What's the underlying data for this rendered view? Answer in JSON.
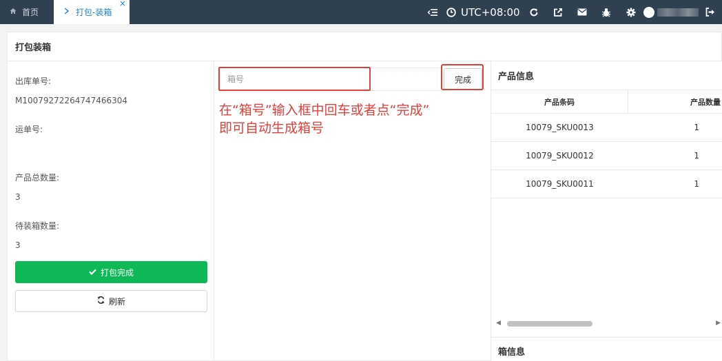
{
  "topbar": {
    "home_tab": "首页",
    "home_icon": "home-icon",
    "active_tab": "打包-装箱",
    "close_glyph": "×",
    "timezone": "UTC+08:00",
    "tools": [
      "menu-collapse-icon",
      "clock-icon",
      "refresh-icon",
      "external-link-icon",
      "mail-icon",
      "bug-icon",
      "gear-icon",
      "user-icon",
      "logout-icon"
    ]
  },
  "page": {
    "title": "打包装箱"
  },
  "left": {
    "outbound_no_label": "出库单号:",
    "outbound_no_value": "M10079272264747466304",
    "waybill_label": "运单号:",
    "waybill_value": "",
    "total_qty_label": "产品总数量:",
    "total_qty_value": "3",
    "pending_qty_label": "待装箱数量:",
    "pending_qty_value": "3",
    "done_button": "打包完成",
    "refresh_button": "刷新"
  },
  "middle": {
    "box_input_placeholder": "箱号",
    "box_input_value": "",
    "finish_button": "完成",
    "hint_line1": "在“箱号”输入框中回车或者点“完成”",
    "hint_line2": "即可自动生成箱号"
  },
  "right": {
    "product_info_title": "产品信息",
    "columns": [
      "产品条码",
      "产品数量"
    ],
    "rows": [
      {
        "barcode": "10079_SKU0013",
        "qty": "1"
      },
      {
        "barcode": "10079_SKU0012",
        "qty": "1"
      },
      {
        "barcode": "10079_SKU0011",
        "qty": "1"
      }
    ],
    "box_info_title": "箱信息"
  },
  "colors": {
    "topbar_bg": "#2f4050",
    "active_tab_text": "#1c84c6",
    "primary_green": "#0fb856",
    "annotation_red": "#e0403a"
  }
}
